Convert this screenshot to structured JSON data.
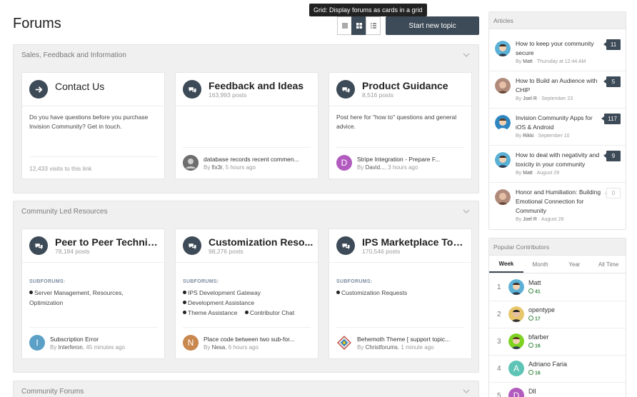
{
  "page": {
    "title": "Forums",
    "start_topic": "Start new topic",
    "tooltip": "Grid: Display forums as cards in a grid"
  },
  "sections": [
    {
      "title": "Sales, Feedback and Information",
      "cards": [
        {
          "title": "Contact Us",
          "description": "Do you have questions before you purchase Invision Community? Get in touch.",
          "footer": "12,433 visits to this link"
        },
        {
          "title": "Feedback and Ideas",
          "posts": "163,993 posts",
          "last_post": {
            "title": "database records recent commen...",
            "author": "fix3r",
            "time": "5 hours ago"
          }
        },
        {
          "title": "Product Guidance",
          "posts": "8,516 posts",
          "description": "Post here for \"how to\" questions and general advice.",
          "last_post": {
            "title": "Stripe Integration - Prepare F...",
            "author": "David...",
            "time": "3 hours ago",
            "initial": "D"
          }
        }
      ]
    },
    {
      "title": "Community Led Resources",
      "subforums_label": "SUBFORUMS:",
      "cards": [
        {
          "title": "Peer to Peer Technic...",
          "posts": "78,184 posts",
          "subforums": [
            "Server Management, Resources, Optimization"
          ],
          "last_post": {
            "title": "Subscription Error",
            "author": "Interferon",
            "time": "45 minutes ago",
            "initial": "I"
          }
        },
        {
          "title": "Customization Reso...",
          "posts": "98,276 posts",
          "subforums": [
            "IPS Development Gateway",
            "Development Assistance",
            "Theme Assistance",
            "Contributor Chat"
          ],
          "last_post": {
            "title": "Place code between two sub-for...",
            "author": "Nesa",
            "time": "6 hours ago",
            "initial": "N"
          }
        },
        {
          "title": "IPS Marketplace Topi...",
          "posts": "170,546 posts",
          "subforums": [
            "Customization Requests"
          ],
          "last_post": {
            "title": "Behemoth Theme [ support topic...",
            "author": "Christforums",
            "time": "1 minute ago"
          }
        }
      ]
    },
    {
      "title": "Community Forums"
    }
  ],
  "articles": {
    "title": "Articles",
    "by": "By",
    "items": [
      {
        "title": "How to keep your community secure",
        "author": "Matt",
        "date": "Thursday at 12:44 AM",
        "count": "11"
      },
      {
        "title": "How to Build an Audience with CHIP",
        "author": "Joel R",
        "date": "September 23",
        "count": "5"
      },
      {
        "title": "Invision Community Apps for iOS & Android",
        "author": "Rikki",
        "date": "September 10",
        "count": "117"
      },
      {
        "title": "How to deal with negativity and toxicity in your community",
        "author": "Matt",
        "date": "August 29",
        "count": "9"
      },
      {
        "title": "Honor and Humiliation: Building Emotional Connection for Community",
        "author": "Joel R",
        "date": "August 28",
        "count": "0"
      }
    ]
  },
  "contributors": {
    "title": "Popular Contributors",
    "tabs": [
      "Week",
      "Month",
      "Year",
      "All Time"
    ],
    "items": [
      {
        "rank": "1",
        "name": "Matt",
        "rep": "41"
      },
      {
        "rank": "2",
        "name": "opentype",
        "rep": "17"
      },
      {
        "rank": "3",
        "name": "bfarber",
        "rep": "16"
      },
      {
        "rank": "4",
        "name": "Adriano Faria",
        "rep": "16",
        "initial": "A"
      },
      {
        "rank": "5",
        "name": "Dll",
        "initial": "D"
      }
    ]
  },
  "colors": {
    "primary": "#3d4a57",
    "rep_green": "#3c8a45"
  }
}
